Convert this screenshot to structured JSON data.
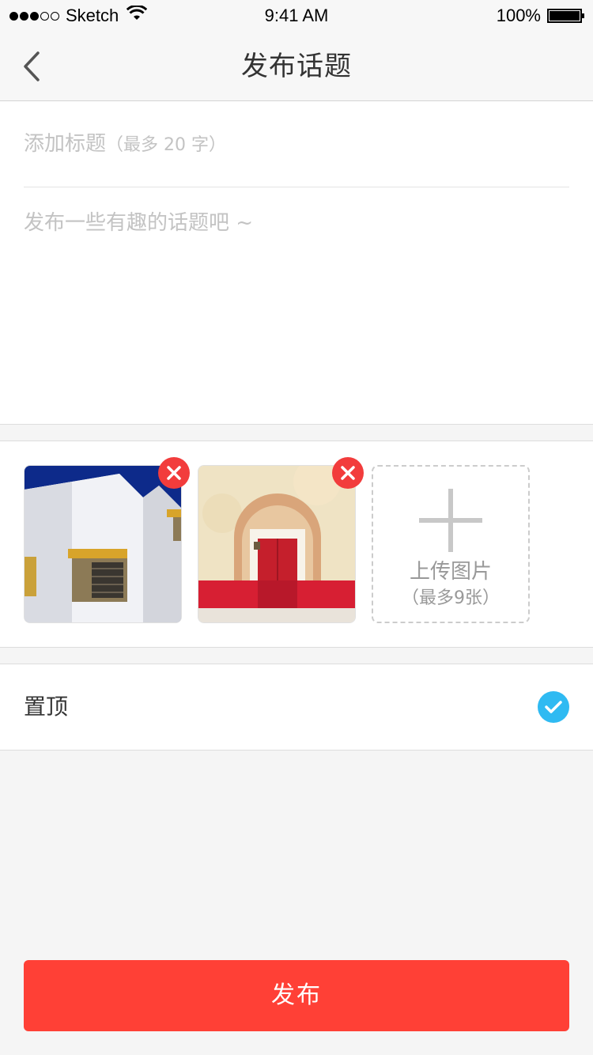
{
  "status_bar": {
    "carrier": "Sketch",
    "time": "9:41 AM",
    "battery": "100%",
    "signal_bars_filled": 3,
    "signal_bars_total": 5
  },
  "nav": {
    "title": "发布话题",
    "back_icon": "chevron-left-icon"
  },
  "editor": {
    "title_placeholder_main": "添加标题",
    "title_placeholder_hint": "（最多 20 字）",
    "body_placeholder": "发布一些有趣的话题吧 ~"
  },
  "photos": {
    "items": [
      {
        "name": "white-building-photo",
        "remove_icon": "close-icon"
      },
      {
        "name": "red-door-photo",
        "remove_icon": "close-icon"
      }
    ],
    "upload_label": "上传图片",
    "upload_hint": "（最多9张）",
    "upload_icon": "plus-icon"
  },
  "pin": {
    "label": "置顶",
    "checked": true,
    "check_icon": "checkmark-icon"
  },
  "publish_button": "发布",
  "colors": {
    "accent_red": "#ff4036",
    "remove_red": "#f23c3c",
    "check_blue": "#2fbaf2",
    "placeholder_gray": "#c3c3c3"
  }
}
